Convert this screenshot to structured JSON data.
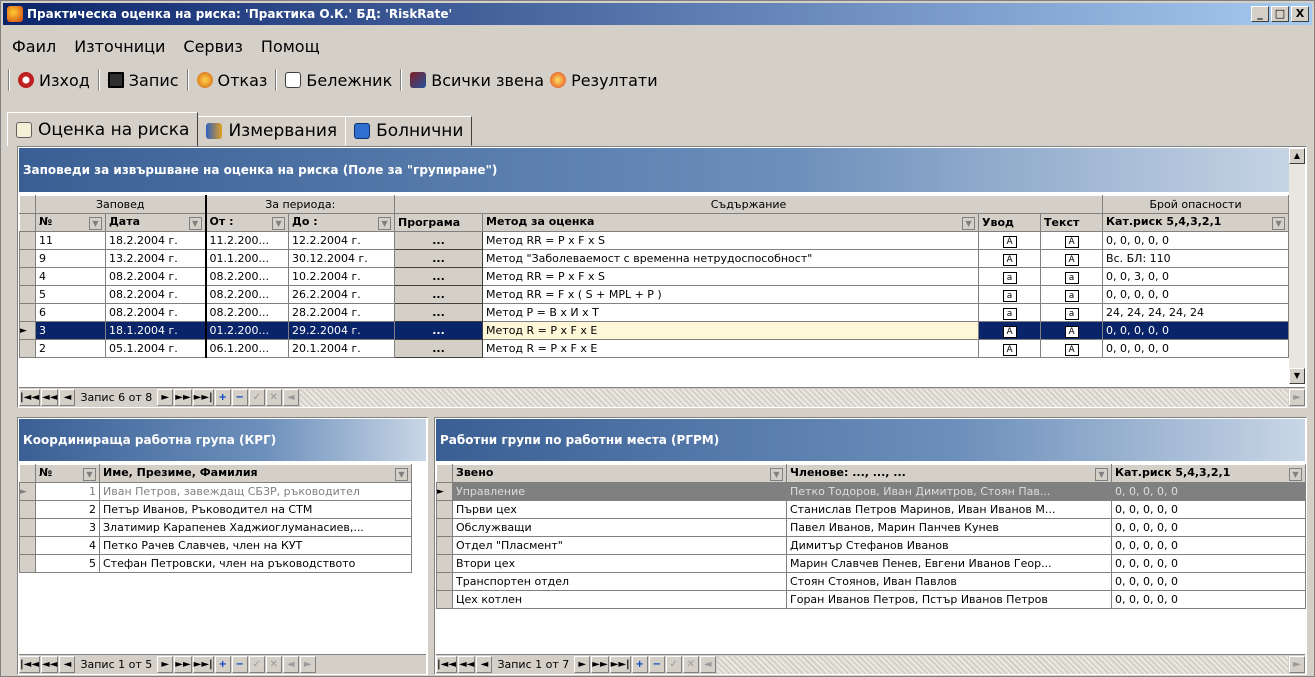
{
  "window": {
    "title": "Практическа оценка на риска:  'Практика О.К.'   БД: 'RiskRate'",
    "controls": [
      "_",
      "□",
      "X"
    ]
  },
  "menu": [
    "Фаил",
    "Източници",
    "Сервиз",
    "Помощ"
  ],
  "toolbar": [
    {
      "label": "Изход",
      "icon": "exit-icon"
    },
    {
      "label": "Запис",
      "icon": "save-icon"
    },
    {
      "label": "Отказ",
      "icon": "cancel-icon"
    },
    {
      "label": "Бележник",
      "icon": "notebook-icon"
    },
    {
      "label": "Всички звена",
      "icon": "all-units-icon"
    },
    {
      "label": "Резултати",
      "icon": "results-icon"
    }
  ],
  "tabs": [
    "Оценка на риска",
    "Измервания",
    "Болнични"
  ],
  "orders": {
    "title": "Заповеди за извършване на оценка на риска (Поле за \"групиране\")",
    "groups": [
      "Заповед",
      "За периода:",
      "Съдържание",
      "Брой опасности"
    ],
    "columns": [
      "№",
      "Дата",
      "От :",
      "До :",
      "Програма",
      "Метод за оценка",
      "Увод",
      "Текст",
      "Кат.риск 5,4,3,2,1"
    ],
    "rows": [
      {
        "no": "11",
        "date": "18.2.2004 г.",
        "from": "11.2.200...",
        "to": "12.2.2004 г.",
        "prog": "...",
        "method": "Метод  RR = P x F x S",
        "intro": "A",
        "text": "A",
        "risk": "0,  0,  0,  0,  0"
      },
      {
        "no": "9",
        "date": "13.2.2004 г.",
        "from": "01.1.200...",
        "to": "30.12.2004 г.",
        "prog": "...",
        "method": "Метод  \"Заболеваемост с временна нетрудоспособност\"",
        "intro": "A",
        "text": "A",
        "risk": "Вс. БЛ:        110"
      },
      {
        "no": "4",
        "date": "08.2.2004 г.",
        "from": "08.2.200...",
        "to": "10.2.2004 г.",
        "prog": "...",
        "method": "Метод  RR = P x F x S",
        "intro": "a",
        "text": "a",
        "risk": "0,  0,  3,  0,  0"
      },
      {
        "no": "5",
        "date": "08.2.2004 г.",
        "from": "08.2.200...",
        "to": "26.2.2004 г.",
        "prog": "...",
        "method": "Метод  RR = F x ( S + MPL + P )",
        "intro": "a",
        "text": "a",
        "risk": "0,  0,  0,  0,  0"
      },
      {
        "no": "6",
        "date": "08.2.2004 г.",
        "from": "08.2.200...",
        "to": "28.2.2004 г.",
        "prog": "...",
        "method": "Метод  P = B x И x T",
        "intro": "a",
        "text": "a",
        "risk": "24, 24, 24, 24, 24"
      },
      {
        "no": "3",
        "date": "18.1.2004 г.",
        "from": "01.2.200...",
        "to": "29.2.2004 г.",
        "prog": "...",
        "method": "Метод  R = P x F x E",
        "intro": "A",
        "text": "A",
        "risk": "0,  0,  0,  0,  0"
      },
      {
        "no": "2",
        "date": "05.1.2004 г.",
        "from": "06.1.200...",
        "to": "20.1.2004 г.",
        "prog": "...",
        "method": "Метод  R = P x F x E",
        "intro": "A",
        "text": "A",
        "risk": "0,  0,  0,  0,  0"
      }
    ],
    "nav_label": "Запис 6 от 8"
  },
  "krg": {
    "title": "Координираща работна група (КРГ)",
    "columns": [
      "№",
      "Име, Презиме, Фамилия"
    ],
    "rows": [
      {
        "no": "1",
        "name": "Иван Петров, завеждащ СБЗР, ръководител"
      },
      {
        "no": "2",
        "name": "Петър Иванов, Ръководител на СТМ"
      },
      {
        "no": "3",
        "name": "Златимир Карапенев Хаджиоглуманасиев,..."
      },
      {
        "no": "4",
        "name": "Петко Рачев Славчев, член на КУТ"
      },
      {
        "no": "5",
        "name": "Стефан Петровски, член на ръководството"
      }
    ],
    "nav_label": "Запис 1 от 5"
  },
  "rgrm": {
    "title": "Работни групи по работни места (РГРМ)",
    "columns": [
      "Звено",
      "Членове: ..., ..., ...",
      "Кат.риск 5,4,3,2,1"
    ],
    "rows": [
      {
        "unit": "Управление",
        "members": "Петко Тодоров, Иван Димитров, Стоян Пав...",
        "risk": "0,  0,  0,  0,  0"
      },
      {
        "unit": "Първи цех",
        "members": "Станислав Петров Маринов, Иван Иванов М...",
        "risk": "0,  0,  0,  0,  0"
      },
      {
        "unit": "Обслужващи",
        "members": "Павел Иванов, Марин Панчев Кунев",
        "risk": "0,  0,  0,  0,  0"
      },
      {
        "unit": "Отдел \"Пласмент\"",
        "members": "Димитър Стефанов Иванов",
        "risk": "0,  0,  0,  0,  0"
      },
      {
        "unit": "Втори цех",
        "members": "Марин Славчев Пенев, Евгени Иванов Геор...",
        "risk": "0,  0,  0,  0,  0"
      },
      {
        "unit": "Транспортен отдел",
        "members": "Стоян Стоянов, Иван Павлов",
        "risk": "0,  0,  0,  0,  0"
      },
      {
        "unit": "Цех котлен",
        "members": "Горан Иванов Петров, Пстър Иванов Петров",
        "risk": "0,  0,  0,  0,  0"
      }
    ],
    "nav_label": "Запис 1 от 7"
  },
  "colors": {
    "selection": "#0a246a",
    "header_gradient_start": "#3a5f94",
    "face": "#d4d0c8"
  }
}
